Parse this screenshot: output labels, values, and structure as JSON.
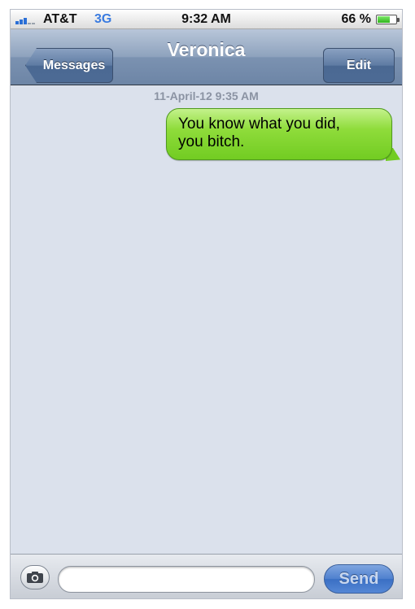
{
  "status_bar": {
    "carrier": "AT&T",
    "network": "3G",
    "time": "9:32 AM",
    "battery_percent_label": "66 %",
    "battery_level": 0.66,
    "signal_bars": 3,
    "signal_bars_total": 5
  },
  "nav_bar": {
    "title": "Veronica",
    "back_label": "Messages",
    "edit_label": "Edit"
  },
  "conversation": {
    "timestamp": "11-April-12  9:35 AM",
    "messages": [
      {
        "direction": "outgoing",
        "lines": [
          "You know what you did,",
          "you bitch."
        ]
      }
    ]
  },
  "input_bar": {
    "message_value": "",
    "send_label": "Send",
    "camera_icon": "camera-icon"
  },
  "colors": {
    "outgoing_bubble": "#8fdc3b",
    "nav_bar": "#8ea2bd",
    "background": "#dbe1ec",
    "send_button": "#4f80cf"
  }
}
